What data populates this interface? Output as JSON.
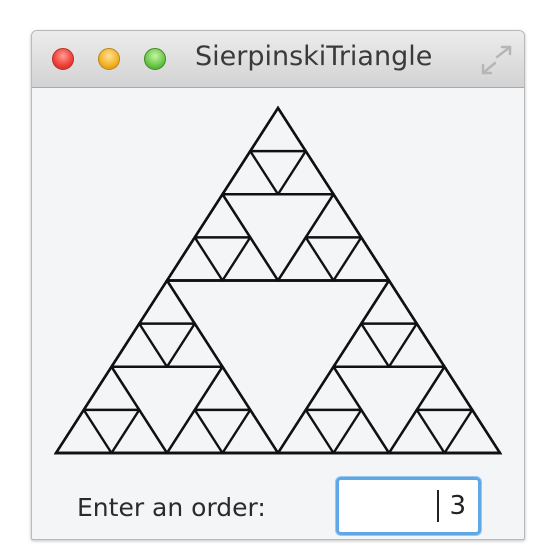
{
  "window": {
    "title": "SierpinskiTriangle"
  },
  "title_bar": {
    "buttons": [
      "close",
      "minimize",
      "zoom"
    ],
    "icons": [
      "close-icon",
      "minimize-icon",
      "zoom-icon",
      "fullscreen-icon"
    ]
  },
  "colors": {
    "close": "#f0443a",
    "minimize": "#f5b52a",
    "zoom": "#6fcb4c",
    "input_focus": "#5fa8e8",
    "line": "#111111",
    "background": "#f4f5f7"
  },
  "fractal": {
    "order": 3
  },
  "form": {
    "label": "Enter an order:",
    "value": "3"
  }
}
